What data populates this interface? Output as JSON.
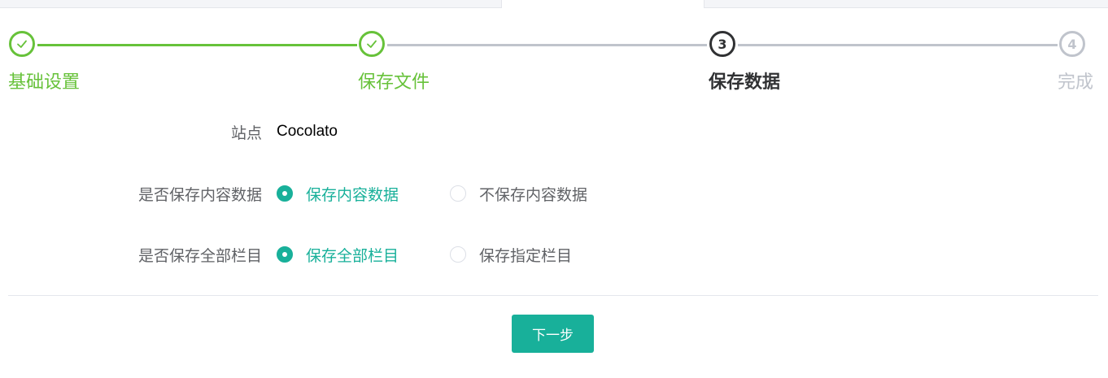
{
  "steps": [
    {
      "number": "1",
      "title": "基础设置",
      "status": "done"
    },
    {
      "number": "2",
      "title": "保存文件",
      "status": "done"
    },
    {
      "number": "3",
      "title": "保存数据",
      "status": "current"
    },
    {
      "number": "4",
      "title": "完成",
      "status": "wait"
    }
  ],
  "form": {
    "site": {
      "label": "站点",
      "value": "Cocolato"
    },
    "save_content": {
      "label": "是否保存内容数据",
      "options": [
        {
          "label": "保存内容数据",
          "checked": true
        },
        {
          "label": "不保存内容数据",
          "checked": false
        }
      ]
    },
    "save_columns": {
      "label": "是否保存全部栏目",
      "options": [
        {
          "label": "保存全部栏目",
          "checked": true
        },
        {
          "label": "保存指定栏目",
          "checked": false
        }
      ]
    }
  },
  "next_button_label": "下一步",
  "colors": {
    "success": "#67c23a",
    "primary": "#18b09a",
    "current": "#303133",
    "wait": "#c0c4cc"
  },
  "icons": {
    "done_step": "check-icon"
  }
}
